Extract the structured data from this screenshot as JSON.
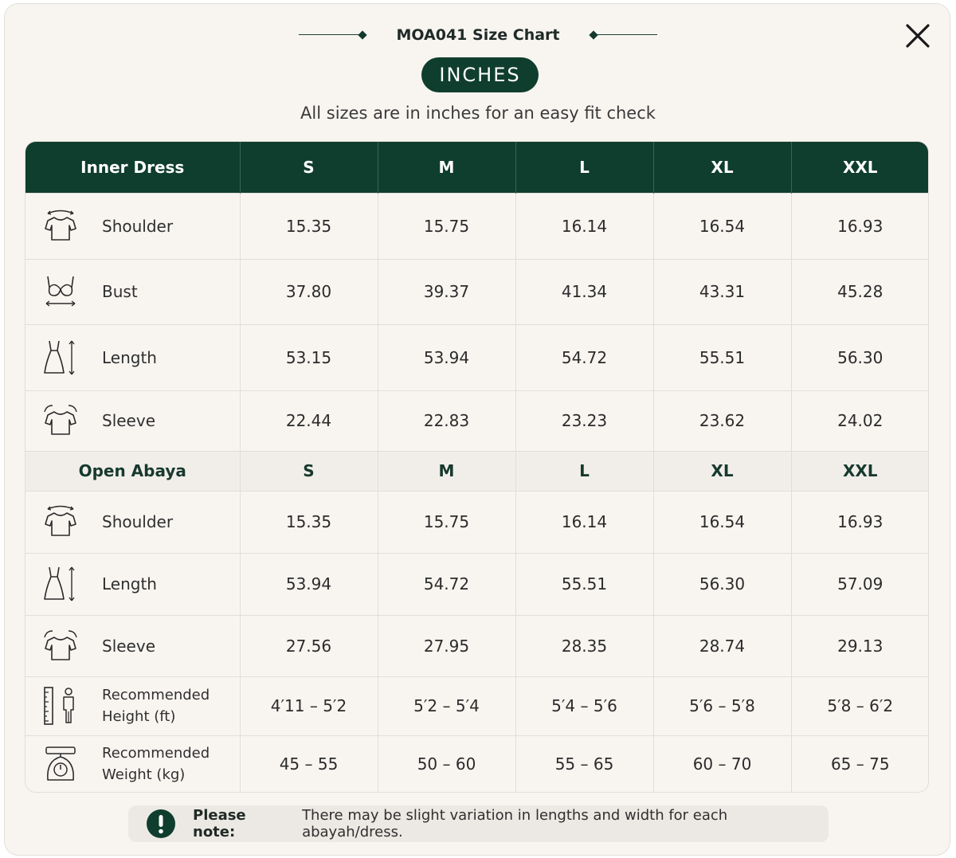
{
  "header": {
    "title": "MOA041 Size Chart",
    "unit_label": "INCHES",
    "subtitle": "All sizes are in inches for an easy fit check",
    "close_icon": "close-icon"
  },
  "table": {
    "header": {
      "section_label": "Inner Dress",
      "sizes": [
        "S",
        "M",
        "L",
        "XL",
        "XXL"
      ]
    },
    "inner_dress_rows": [
      {
        "icon": "shirt-width-icon",
        "label": "Shoulder",
        "values": [
          "15.35",
          "15.75",
          "16.14",
          "16.54",
          "16.93"
        ]
      },
      {
        "icon": "bra-icon",
        "label": "Bust",
        "values": [
          "37.80",
          "39.37",
          "41.34",
          "43.31",
          "45.28"
        ]
      },
      {
        "icon": "dress-length-icon",
        "label": "Length",
        "values": [
          "53.15",
          "53.94",
          "54.72",
          "55.51",
          "56.30"
        ]
      },
      {
        "icon": "sleeve-icon",
        "label": "Sleeve",
        "values": [
          "22.44",
          "22.83",
          "23.23",
          "23.62",
          "24.02"
        ]
      }
    ],
    "open_abaya_header": {
      "section_label": "Open Abaya",
      "sizes": [
        "S",
        "M",
        "L",
        "XL",
        "XXL"
      ]
    },
    "open_abaya_rows": [
      {
        "icon": "shirt-width-icon",
        "label": "Shoulder",
        "values": [
          "15.35",
          "15.75",
          "16.14",
          "16.54",
          "16.93"
        ]
      },
      {
        "icon": "dress-length-icon",
        "label": "Length",
        "values": [
          "53.94",
          "54.72",
          "55.51",
          "56.30",
          "57.09"
        ]
      },
      {
        "icon": "sleeve-icon",
        "label": "Sleeve",
        "values": [
          "27.56",
          "27.95",
          "28.35",
          "28.74",
          "29.13"
        ]
      },
      {
        "icon": "height-icon",
        "label": "Recommended\nHeight (ft)",
        "values": [
          "4′11 – 5′2",
          "5′2 – 5′4",
          "5′4 – 5′6",
          "5′6 – 5′8",
          "5′8 – 6′2"
        ]
      },
      {
        "icon": "scale-icon",
        "label": "Recommended\nWeight (kg)",
        "values": [
          "45 – 55",
          "50 – 60",
          "55 – 65",
          "60 – 70",
          "65 – 75"
        ]
      }
    ]
  },
  "note": {
    "icon": "exclamation-icon",
    "label": "Please note:",
    "text": "There may be slight variation in lengths and width for each abayah/dress."
  },
  "colors": {
    "brand_green": "#0f3d2e",
    "background": "#f8f5f1",
    "section_row": "#f1eeea"
  }
}
